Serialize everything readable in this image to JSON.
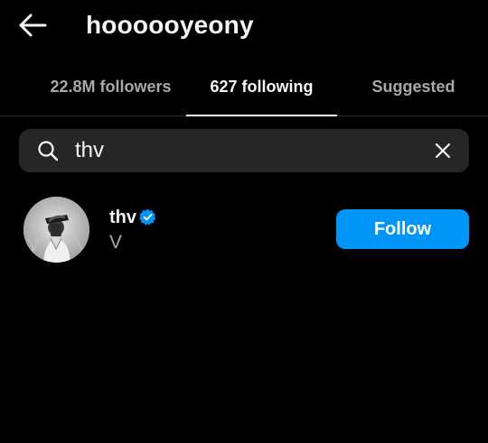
{
  "header": {
    "back_icon": "arrow-left-icon",
    "title": "hoooooyeony"
  },
  "tabs": [
    {
      "label": "22.8M followers",
      "active": false
    },
    {
      "label": "627 following",
      "active": true
    },
    {
      "label": "Suggested",
      "active": false
    }
  ],
  "search": {
    "icon": "search-icon",
    "value": "thv",
    "placeholder": "",
    "clear_icon": "close-icon"
  },
  "results": [
    {
      "username": "thv",
      "verified": true,
      "full_name": "V",
      "follow_label": "Follow"
    }
  ],
  "colors": {
    "background": "#000000",
    "accent": "#0095f6",
    "search_bg": "#262626",
    "muted_text": "#a8a8a8"
  }
}
